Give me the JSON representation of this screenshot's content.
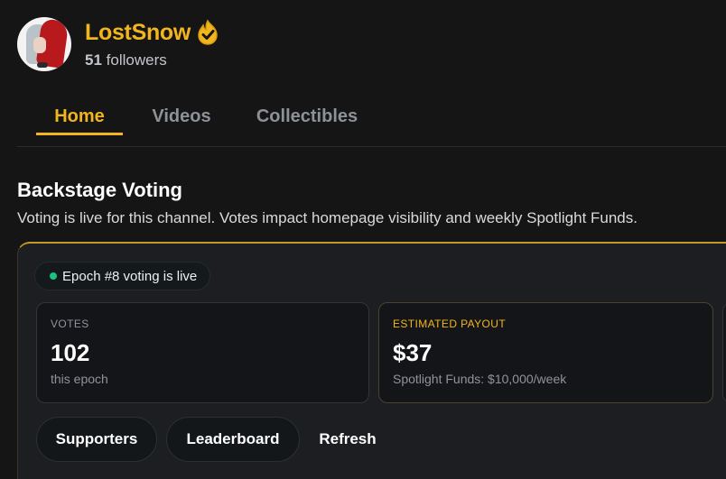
{
  "channel": {
    "name": "LostSnow",
    "badge_icon": "flame-check-badge-icon",
    "followers_count": "51",
    "followers_label": "followers"
  },
  "tabs": [
    {
      "label": "Home",
      "active": true
    },
    {
      "label": "Videos",
      "active": false
    },
    {
      "label": "Collectibles",
      "active": false
    }
  ],
  "voting": {
    "title": "Backstage Voting",
    "description": "Voting is live for this channel. Votes impact homepage visibility and weekly Spotlight Funds.",
    "status": "Epoch #8 voting is live",
    "stats": [
      {
        "label": "VOTES",
        "value": "102",
        "sub": "this epoch"
      },
      {
        "label": "ESTIMATED PAYOUT",
        "value": "$37",
        "sub": "Spotlight Funds: $10,000/week"
      }
    ],
    "buttons": {
      "supporters": "Supporters",
      "leaderboard": "Leaderboard",
      "refresh": "Refresh"
    }
  },
  "colors": {
    "accent": "#f2b51d",
    "background": "#151516",
    "live": "#19c37d"
  }
}
